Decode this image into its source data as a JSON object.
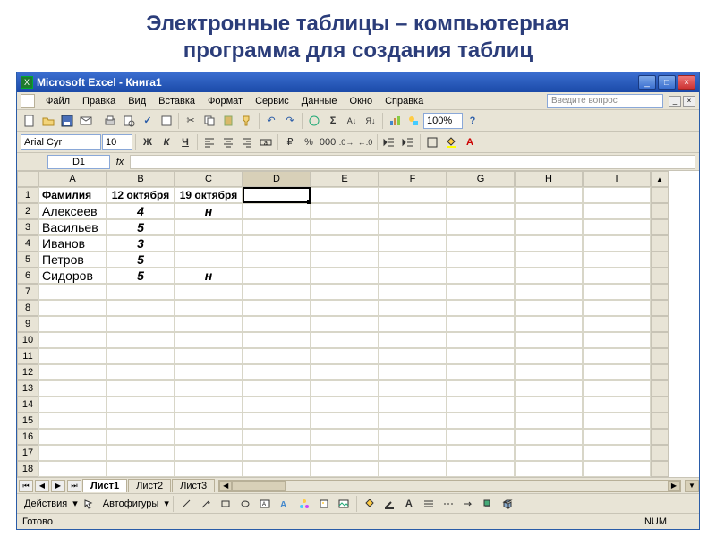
{
  "slide": {
    "title_line1": "Электронные таблицы – компьютерная",
    "title_line2": "программа для создания таблиц"
  },
  "titlebar": {
    "text": "Microsoft Excel - Книга1"
  },
  "window_buttons": {
    "min": "_",
    "max": "□",
    "close": "×"
  },
  "menu": {
    "items": [
      "Файл",
      "Правка",
      "Вид",
      "Вставка",
      "Формат",
      "Сервис",
      "Данные",
      "Окно",
      "Справка"
    ],
    "help_placeholder": "Введите вопрос"
  },
  "format": {
    "font": "Arial Cyr",
    "size": "10",
    "zoom": "100%"
  },
  "buttons": {
    "bold": "Ж",
    "italic": "К",
    "underline": "Ч",
    "currency": "₽",
    "percent": "%",
    "thousands": "000"
  },
  "namebox": {
    "cell": "D1",
    "fx": "fx"
  },
  "columns": [
    "A",
    "B",
    "C",
    "D",
    "E",
    "F",
    "G",
    "H",
    "I"
  ],
  "active_col": "D",
  "rows_shown": 18,
  "headers": {
    "A": "Фамилия",
    "B": "12 октября",
    "C": "19 октября"
  },
  "data_rows": [
    {
      "A": "Алексеев",
      "B": "4",
      "C": "н"
    },
    {
      "A": "Васильев",
      "B": "5",
      "C": ""
    },
    {
      "A": "Иванов",
      "B": "3",
      "C": ""
    },
    {
      "A": "Петров",
      "B": "5",
      "C": ""
    },
    {
      "A": "Сидоров",
      "B": "5",
      "C": "н"
    }
  ],
  "sheets": {
    "tabs": [
      "Лист1",
      "Лист2",
      "Лист3"
    ],
    "active": "Лист1"
  },
  "drawing": {
    "actions": "Действия",
    "autoshapes": "Автофигуры"
  },
  "status": {
    "ready": "Готово",
    "num": "NUM"
  }
}
